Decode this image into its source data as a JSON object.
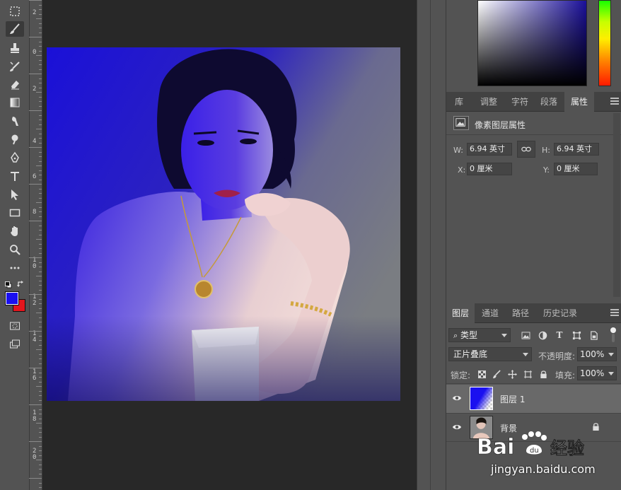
{
  "colors": {
    "foreground": "#1a10f0",
    "background": "#e3161d",
    "accent_blue": "#1a10e8"
  },
  "ruler": {
    "labels": [
      "2",
      "0",
      "2",
      "4",
      "6",
      "8",
      "1\n0",
      "1\n2",
      "1\n4",
      "1\n6",
      "1\n8",
      "2\n0"
    ]
  },
  "properties": {
    "tabs": [
      "库",
      "调整",
      "字符",
      "段落",
      "属性"
    ],
    "active_tab": "属性",
    "title": "像素图层属性",
    "w_label": "W:",
    "w_value": "6.94 英寸",
    "h_label": "H:",
    "h_value": "6.94 英寸",
    "x_label": "X:",
    "x_value": "0 厘米",
    "y_label": "Y:",
    "y_value": "0 厘米"
  },
  "layers": {
    "tabs": [
      "图层",
      "通道",
      "路径",
      "历史记录"
    ],
    "active_tab": "图层",
    "filter_label": "类型",
    "blend_mode": "正片叠底",
    "opacity_label": "不透明度:",
    "opacity_value": "100%",
    "lock_label": "锁定:",
    "fill_label": "填充:",
    "fill_value": "100%",
    "items": [
      {
        "name": "图层 1",
        "selected": true,
        "locked": false
      },
      {
        "name": "背景",
        "selected": false,
        "locked": true
      }
    ]
  },
  "watermark": {
    "brand": "Baidu经验",
    "url": "jingyan.baidu.com"
  }
}
